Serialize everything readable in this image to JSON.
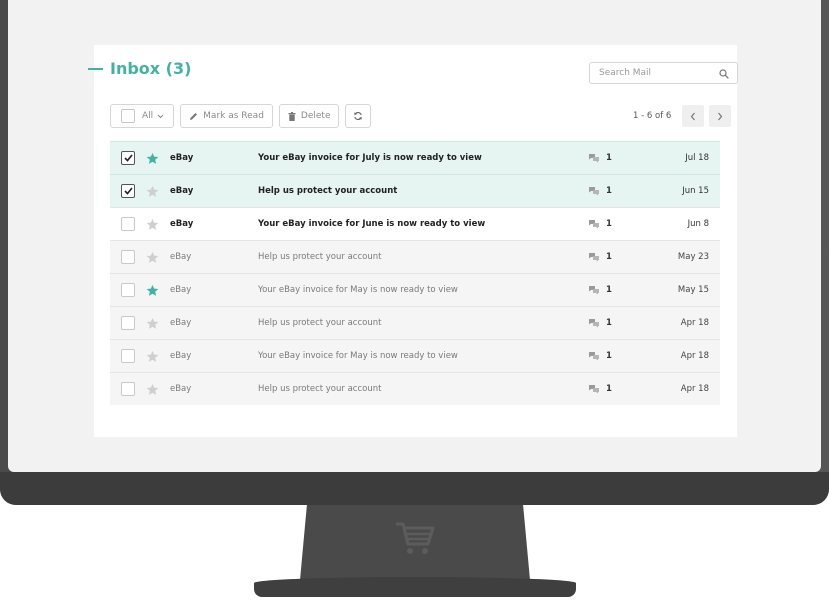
{
  "inbox": {
    "title": "Inbox (3)"
  },
  "search": {
    "placeholder": "Search Mail"
  },
  "toolbar": {
    "all_label": "All",
    "mark_read_label": "Mark as Read",
    "delete_label": "Delete"
  },
  "pager": {
    "text": "1 - 6 of 6"
  },
  "colors": {
    "accent": "#46b1a3",
    "selected_row": "#e6f4f2",
    "read_row": "#f5f5f5",
    "star_active": "#46b1a3",
    "star_inactive": "#cfcfcf"
  },
  "mails": [
    {
      "sender": "eBay",
      "subject": "Your eBay invoice for July is now ready to view",
      "count": "1",
      "date": "Jul 18",
      "checked": true,
      "starred": true,
      "unread": true,
      "selected": true
    },
    {
      "sender": "eBay",
      "subject": "Help us protect your account",
      "count": "1",
      "date": "Jun 15",
      "checked": true,
      "starred": false,
      "unread": true,
      "selected": true
    },
    {
      "sender": "eBay",
      "subject": "Your eBay invoice for June is now ready to view",
      "count": "1",
      "date": "Jun 8",
      "checked": false,
      "starred": false,
      "unread": true,
      "selected": false
    },
    {
      "sender": "eBay",
      "subject": "Help us protect your account",
      "count": "1",
      "date": "May 23",
      "checked": false,
      "starred": false,
      "unread": false,
      "selected": false
    },
    {
      "sender": "eBay",
      "subject": "Your eBay invoice for May is now ready to view",
      "count": "1",
      "date": "May 15",
      "checked": false,
      "starred": true,
      "unread": false,
      "selected": false
    },
    {
      "sender": "eBay",
      "subject": "Help us protect your account",
      "count": "1",
      "date": "Apr 18",
      "checked": false,
      "starred": false,
      "unread": false,
      "selected": false
    },
    {
      "sender": "eBay",
      "subject": "Your eBay invoice for May is now ready to view",
      "count": "1",
      "date": "Apr 18",
      "checked": false,
      "starred": false,
      "unread": false,
      "selected": false
    },
    {
      "sender": "eBay",
      "subject": "Help us protect your account",
      "count": "1",
      "date": "Apr 18",
      "checked": false,
      "starred": false,
      "unread": false,
      "selected": false
    }
  ]
}
